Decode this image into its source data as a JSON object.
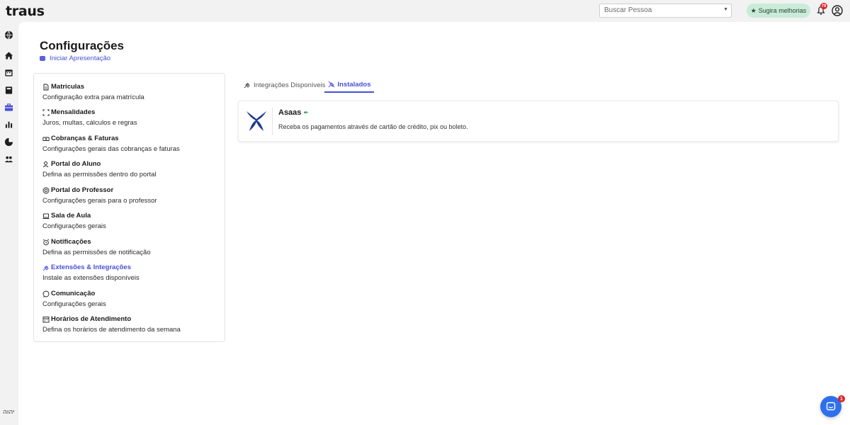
{
  "app": {
    "logo": "traus"
  },
  "header": {
    "search_placeholder": "Buscar Pessoa",
    "suggest_label": "Sugira melhorias",
    "notifications_count": "79"
  },
  "rail": {
    "icons": [
      "globe-icon",
      "home-icon",
      "calendar-icon",
      "book-icon",
      "briefcase-icon",
      "bar-chart-icon",
      "pie-chart-icon",
      "users-icon"
    ],
    "bottom_text": "יהוה"
  },
  "page": {
    "title": "Configurações",
    "presentation_link": "Iniciar Apresentação"
  },
  "settings": [
    {
      "title": "Matrículas",
      "desc": "Configuração extra para matrícula",
      "icon": "document-icon"
    },
    {
      "title": "Mensalidades",
      "desc": "Juros, multas, cálculos e regras",
      "icon": "expand-icon"
    },
    {
      "title": "Cobranças & Faturas",
      "desc": "Configurações gerais das cobranças e faturas",
      "icon": "money-icon"
    },
    {
      "title": "Portal do Aluno",
      "desc": "Defina as permissões dentro do portal",
      "icon": "student-icon"
    },
    {
      "title": "Portal do Professor",
      "desc": "Configurações gerais para o professor",
      "icon": "target-icon"
    },
    {
      "title": "Sala de Aula",
      "desc": "Configurações gerais",
      "icon": "laptop-icon"
    },
    {
      "title": "Notificações",
      "desc": "Defina as permissões de notificação",
      "icon": "alarm-icon"
    },
    {
      "title": "Extensões & Integrações",
      "desc": "Instale as extensões disponíveis",
      "icon": "plug-icon"
    },
    {
      "title": "Comunicação",
      "desc": "Configurações gerais",
      "icon": "chat-bubble-icon"
    },
    {
      "title": "Horários de Atendimento",
      "desc": "Defina os horários de atendimento da semana",
      "icon": "calendar-icon"
    }
  ],
  "tabs": {
    "available": "Integrações Disponíveis",
    "installed": "Instalados"
  },
  "integration": {
    "name": "Asaas",
    "description": "Receba os pagamentos através de cartão de crédito, pix ou boleto."
  },
  "chat": {
    "badge": "1"
  },
  "colors": {
    "accent": "#4a4fd6",
    "suggest_bg": "#c9ecd9",
    "chat": "#2f6fec",
    "badge": "#d9252b",
    "asaas_logo": "#1f3a8f"
  }
}
